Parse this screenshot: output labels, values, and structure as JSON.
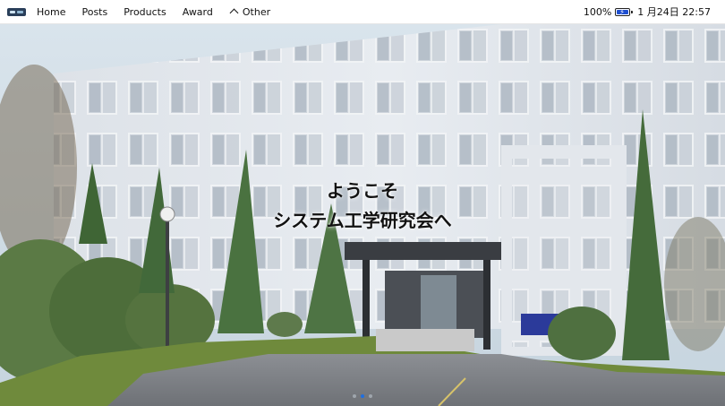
{
  "nav": {
    "items": [
      "Home",
      "Posts",
      "Products",
      "Award"
    ],
    "other_label": "Other"
  },
  "status": {
    "battery_text": "100%",
    "battery_level": 100,
    "date_time": "1 月24日 22:57"
  },
  "hero": {
    "welcome_line1": "ようこそ",
    "welcome_line2": "システム工学研究会へ",
    "slide_count": 3,
    "active_slide": 2
  },
  "colors": {
    "accent": "#1f6fe0",
    "battery": "#1f4fd0"
  },
  "icons": [
    "logo-icon",
    "chevron-up-icon",
    "battery-icon"
  ]
}
